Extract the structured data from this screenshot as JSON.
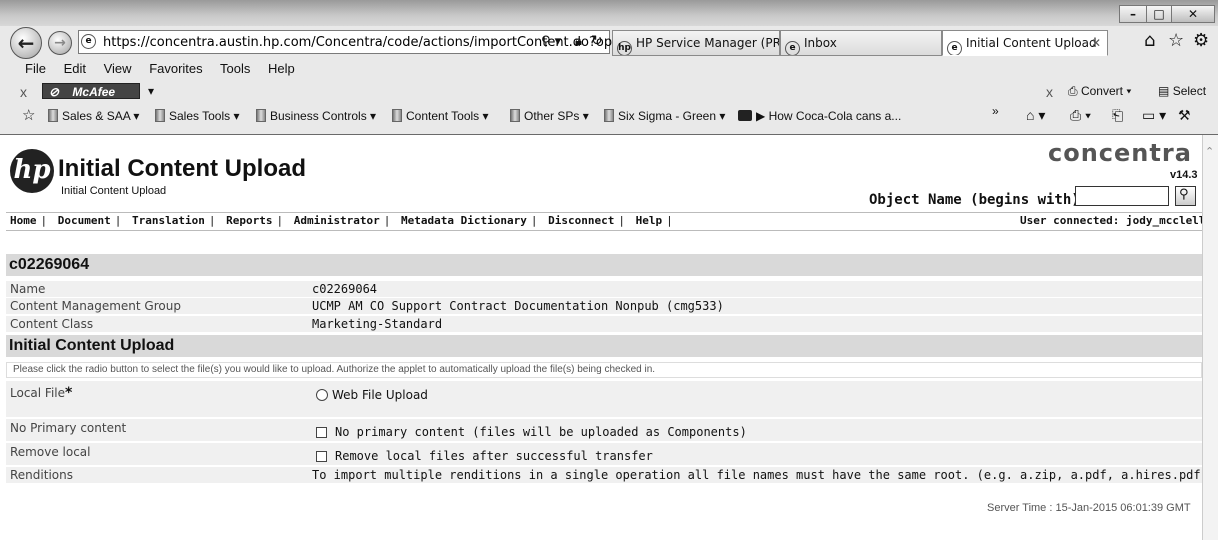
{
  "browser": {
    "address": "https://concentra.austin.hp.com/Concentra/code/actions/importContent.do?ope",
    "tabs": [
      {
        "label": "HP Service Manager (PR...",
        "active": false
      },
      {
        "label": "Inbox",
        "active": false
      },
      {
        "label": "Initial Content Upload",
        "active": true
      }
    ],
    "menu": [
      "File",
      "Edit",
      "View",
      "Favorites",
      "Tools",
      "Help"
    ],
    "mcafee_label": "McAfee",
    "convert_label": "Convert",
    "select_label": "Select",
    "favorites": [
      {
        "label": "Sales & SAA",
        "dropdown": true
      },
      {
        "label": "Sales Tools",
        "dropdown": true
      },
      {
        "label": "Business Controls",
        "dropdown": true
      },
      {
        "label": "Content Tools",
        "dropdown": true
      },
      {
        "label": "Other SPs",
        "dropdown": true
      },
      {
        "label": "Six Sigma - Green",
        "dropdown": true
      },
      {
        "label": "▶ How Coca-Cola cans a...",
        "dropdown": false
      }
    ],
    "more_favorites": "»"
  },
  "header": {
    "title": "Initial Content Upload",
    "subtitle": "Initial Content Upload",
    "logo_right": "concentra",
    "version": "v14.3",
    "object_name_label": "Object Name (begins with):",
    "object_name_value": ""
  },
  "nav": {
    "links": [
      "Home",
      "Document",
      "Translation",
      "Reports",
      "Administrator",
      "Metadata Dictionary",
      "Disconnect",
      "Help"
    ],
    "trailing_sep": "|",
    "user_connected": "User connected: jody_mcclellan"
  },
  "document": {
    "id_title": "c02269064",
    "fields": [
      {
        "label": "Name",
        "value": "c02269064"
      },
      {
        "label": "Content Management Group",
        "value": "UCMP AM CO Support Contract Documentation Nonpub (cmg533)"
      },
      {
        "label": "Content Class",
        "value": "Marketing-Standard"
      }
    ]
  },
  "upload": {
    "section_title": "Initial Content Upload",
    "instructions": "Please click the radio button to select the file(s) you would like to upload. Authorize the applet to automatically upload the file(s) being checked in.",
    "local_file_label": "Local File",
    "required_marker": "*",
    "web_upload_label": "Web File Upload",
    "no_primary_label": "No Primary content",
    "no_primary_option": "No primary content (files will be uploaded as Components)",
    "remove_local_label": "Remove local",
    "remove_local_option": "Remove local files after successful transfer",
    "renditions_label": "Renditions",
    "renditions_text": "To import multiple renditions in a single operation all file names must have the same root. (e.g. a.zip, a.pdf, a.hires.pdf)"
  },
  "footer": {
    "server_time": "Server Time : 15-Jan-2015 06:01:39 GMT"
  }
}
